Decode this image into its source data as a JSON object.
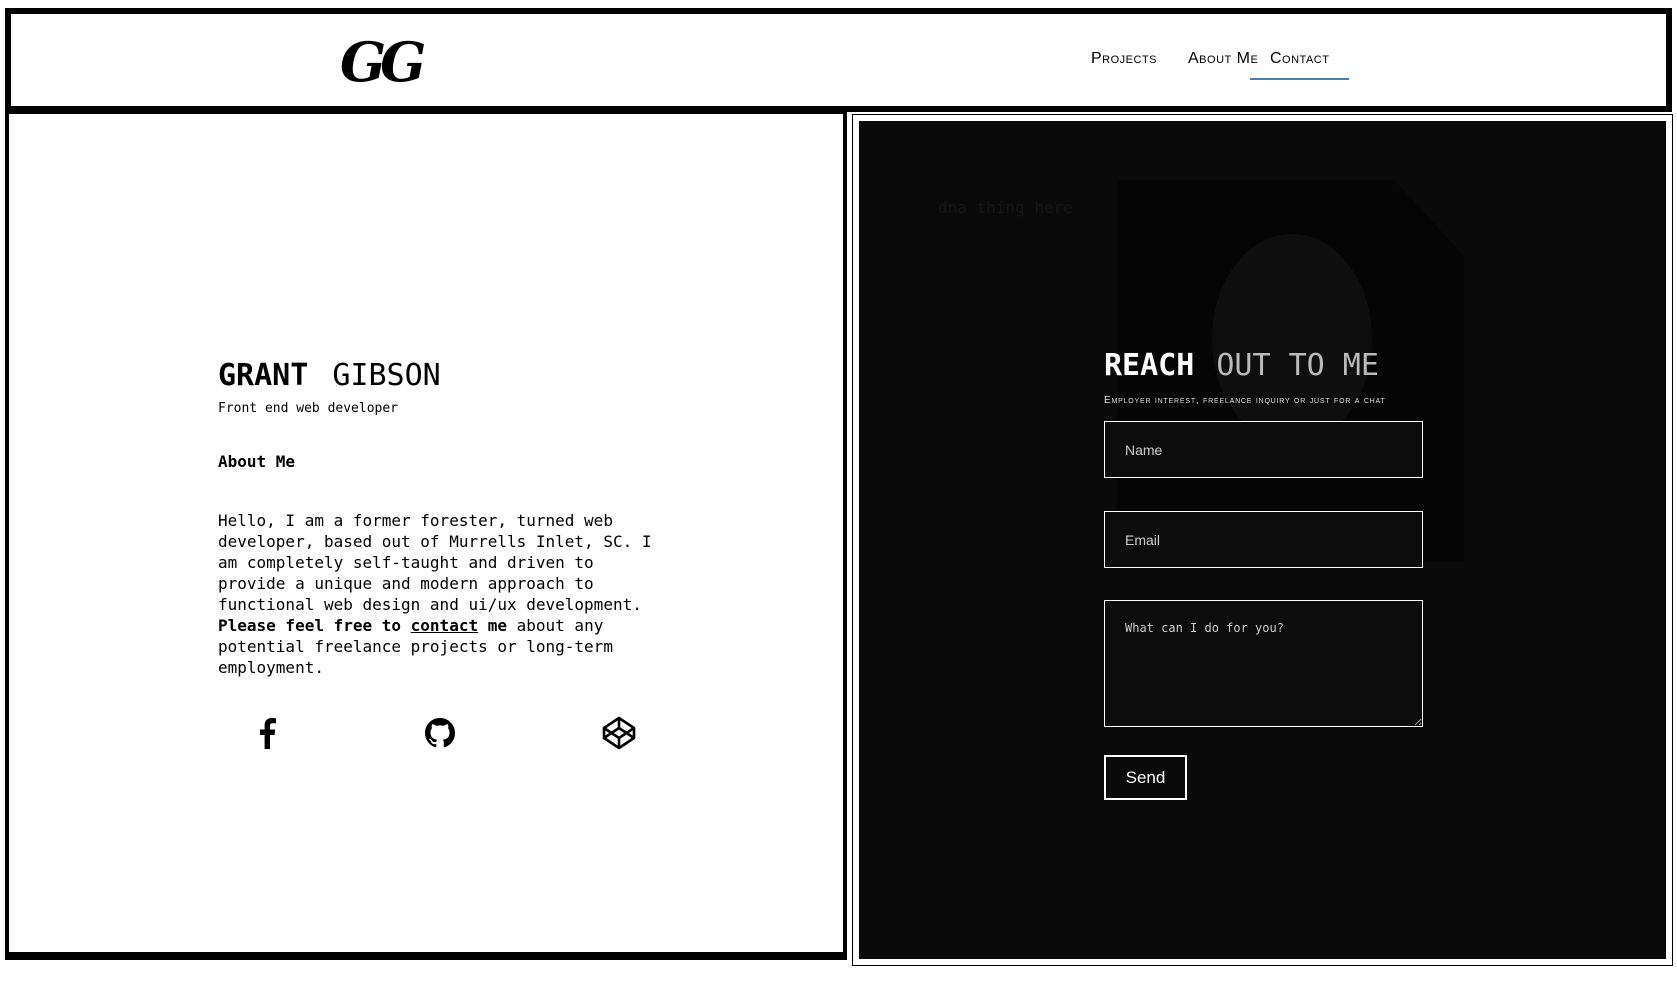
{
  "header": {
    "logo": "GG",
    "nav": {
      "projects": "Projects",
      "about": "About Me",
      "contact": "Contact"
    },
    "active_nav_color": "#4a7fb0"
  },
  "profile": {
    "first_name": "GRANT",
    "last_name": "GIBSON",
    "subtitle": "Front end web developer",
    "about_heading": "About Me",
    "bio_plain_1": "Hello, I am a former forester, turned web developer, based out of Murrells Inlet, SC. I am completely self-taught and driven to provide a unique and modern approach to functional web design and ui/ux development. ",
    "bio_bold_1": "Please feel free to ",
    "bio_link": "contact",
    "bio_bold_2": " me",
    "bio_plain_2": " about any potential freelance projects or long-term employment."
  },
  "social": {
    "icons": [
      "facebook-icon",
      "github-icon",
      "codepen-icon"
    ]
  },
  "contact_panel": {
    "placeholder_text": "dna thing here",
    "title_first": "REACH",
    "title_rest": "OUT TO ME",
    "subtitle": "Employer interest, freelance inquiry or just for a chat",
    "name_placeholder": "Name",
    "email_placeholder": "Email",
    "message_placeholder": "What can I do for you?",
    "send_label": "Send"
  }
}
